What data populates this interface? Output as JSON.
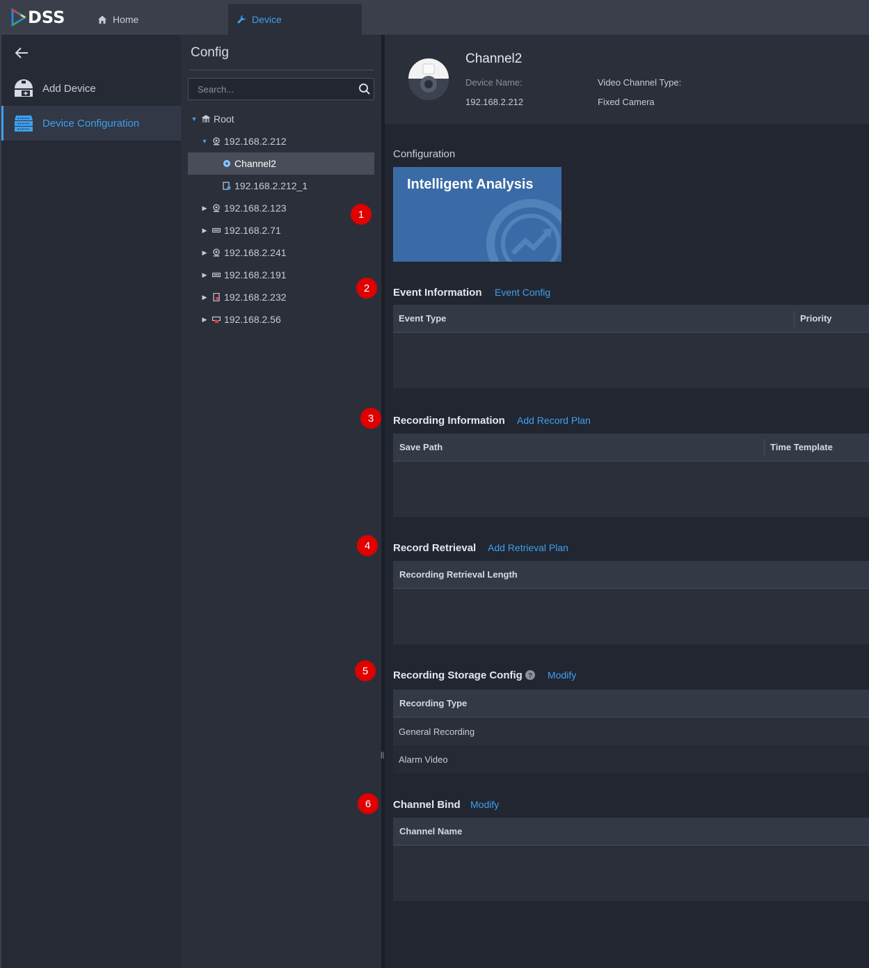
{
  "app": {
    "logo": "DSS",
    "brand_colors": [
      "#e53935",
      "#43a047",
      "#1e88e5",
      "#fdd835"
    ]
  },
  "tabs": [
    {
      "label": "Home",
      "icon": "home-icon"
    },
    {
      "label": "Device",
      "icon": "wrench-icon",
      "active": true
    }
  ],
  "leftnav": {
    "back_icon": "back-arrow-icon",
    "items": [
      {
        "label": "Add Device",
        "icon": "add-device-icon"
      },
      {
        "label": "Device Configuration",
        "icon": "device-config-icon",
        "active": true
      }
    ]
  },
  "tree": {
    "title": "Config",
    "search_placeholder": "Search...",
    "nodes": [
      {
        "label": "Root",
        "icon": "root-icon",
        "expanded": true
      },
      {
        "label": "192.168.2.212",
        "icon": "camera-icon",
        "expanded": true
      },
      {
        "label": "Channel2",
        "icon": "channel-icon",
        "selected": true
      },
      {
        "label": "192.168.2.212_1",
        "icon": "alarm-input-icon"
      },
      {
        "label": "192.168.2.123",
        "icon": "camera-icon"
      },
      {
        "label": "192.168.2.71",
        "icon": "nvr-icon"
      },
      {
        "label": "192.168.2.241",
        "icon": "camera-icon"
      },
      {
        "label": "192.168.2.191",
        "icon": "nvr-icon"
      },
      {
        "label": "192.168.2.232",
        "icon": "door-device-icon"
      },
      {
        "label": "192.168.2.56",
        "icon": "device-red-icon"
      }
    ]
  },
  "header": {
    "channel_name": "Channel2",
    "device_name_label": "Device Name:",
    "device_name_value": "192.168.2.212",
    "video_type_label": "Video Channel Type:",
    "video_type_value": "Fixed Camera"
  },
  "configuration": {
    "label": "Configuration",
    "card_title": "Intelligent Analysis",
    "card_color": "#3a6ba6"
  },
  "sections": {
    "event": {
      "title": "Event Information",
      "link": "Event Config",
      "columns": [
        "Event Type",
        "Priority"
      ]
    },
    "recording": {
      "title": "Recording Information",
      "link": "Add Record Plan",
      "columns": [
        "Save Path",
        "Time Template"
      ]
    },
    "retrieval": {
      "title": "Record Retrieval",
      "link": "Add Retrieval Plan",
      "columns": [
        "Recording Retrieval Length"
      ]
    },
    "storage": {
      "title": "Recording Storage Config",
      "link": "Modify",
      "help_icon": "help-icon",
      "columns": [
        "Recording Type"
      ],
      "rows": [
        "General Recording",
        "Alarm Video"
      ]
    },
    "bind": {
      "title": "Channel Bind",
      "link": "Modify",
      "columns": [
        "Channel Name"
      ]
    }
  },
  "badges": [
    "1",
    "2",
    "3",
    "4",
    "5",
    "6"
  ],
  "accent": "#3ea1ef"
}
